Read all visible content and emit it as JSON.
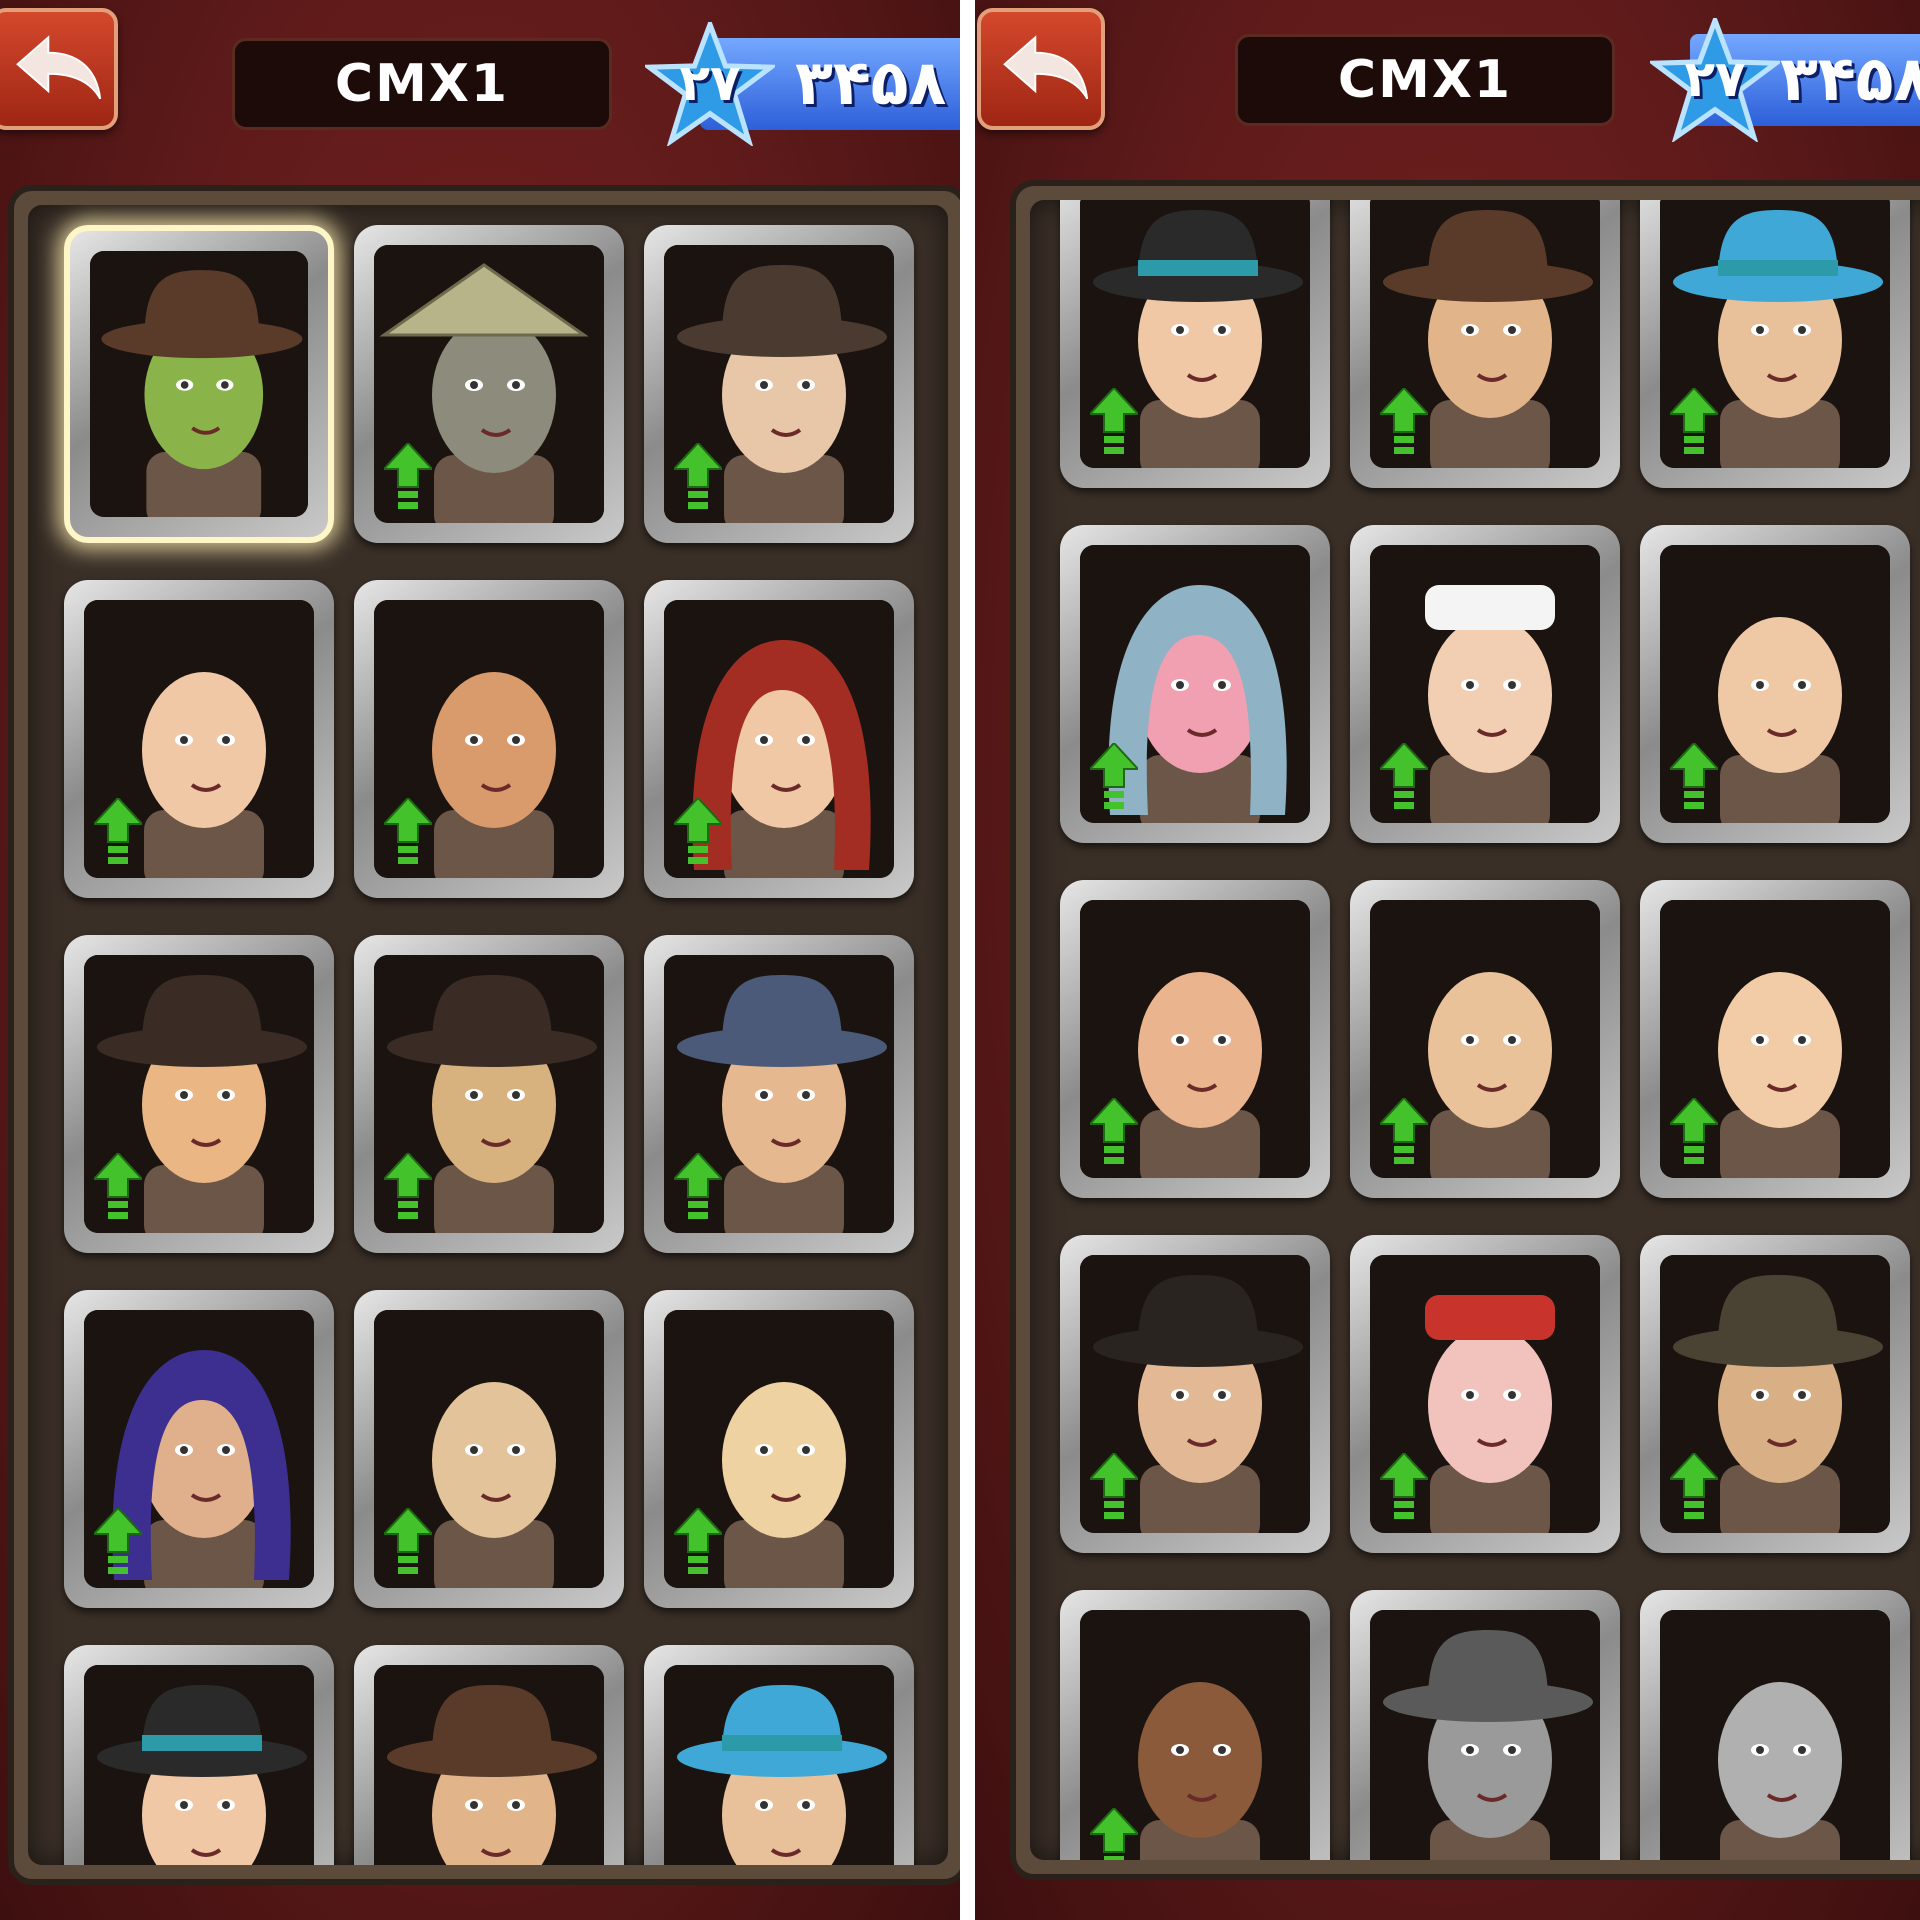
{
  "header": {
    "player_name": "CMX1",
    "level": "۲۷",
    "score": "۳۴۵۸"
  },
  "colors": {
    "background": "#5e1a1a",
    "back_button": "#c23a20",
    "star": "#2f9be6",
    "score_bar": "#3b6fe0",
    "upgrade_arrow": "#44c22c",
    "panel": "#3a2f27"
  },
  "left_screen": {
    "selected_card": 0,
    "cards": [
      {
        "character": "zombie-fedora",
        "skin": "#8ab34a",
        "hat": "fedora-brown",
        "upgrade": false
      },
      {
        "character": "conical-hat-masked-woman",
        "skin": "#8c8b7c",
        "hat": "conical",
        "upgrade": true
      },
      {
        "character": "goggles-pilot-woman",
        "skin": "#e8c6a8",
        "hat": "goggles",
        "upgrade": true
      },
      {
        "character": "curly-hair-woman",
        "skin": "#f0c8a6",
        "hat": "none",
        "upgrade": true
      },
      {
        "character": "bald-thug",
        "skin": "#d99a6c",
        "hat": "none",
        "upgrade": true
      },
      {
        "character": "red-hood-woman",
        "skin": "#f0c8a6",
        "hat": "red-hood",
        "upgrade": true
      },
      {
        "character": "fat-fedora-gangster",
        "skin": "#e9b684",
        "hat": "fedora-dark",
        "upgrade": true
      },
      {
        "character": "glasses-fedora-man",
        "skin": "#d7b27f",
        "hat": "fedora-dark",
        "upgrade": true
      },
      {
        "character": "helmet-masked-rider",
        "skin": "#e6b88f",
        "hat": "helmet-blue",
        "upgrade": true
      },
      {
        "character": "purple-veil-woman",
        "skin": "#e0b08c",
        "hat": "purple-veil",
        "upgrade": true
      },
      {
        "character": "sunglasses-fur-lady",
        "skin": "#e3c39a",
        "hat": "none",
        "upgrade": true
      },
      {
        "character": "scarred-tattoo-man",
        "skin": "#efd2a2",
        "hat": "none",
        "upgrade": true
      },
      {
        "character": "teal-band-hat-woman",
        "skin": "#f0c8a6",
        "hat": "cloche-teal",
        "upgrade": false
      },
      {
        "character": "brown-fedora-man",
        "skin": "#e2b489",
        "hat": "fedora-brown",
        "upgrade": false
      },
      {
        "character": "blue-helmet-policeman",
        "skin": "#e8c09a",
        "hat": "bobby-blue",
        "upgrade": false
      }
    ]
  },
  "right_screen": {
    "cards": [
      {
        "character": "teal-band-hat-woman",
        "skin": "#f0c8a6",
        "hat": "cloche-teal",
        "upgrade": true
      },
      {
        "character": "brown-fedora-man",
        "skin": "#e2b489",
        "hat": "fedora-brown",
        "upgrade": true
      },
      {
        "character": "blue-helmet-policeman",
        "skin": "#e8c09a",
        "hat": "bobby-blue",
        "upgrade": true
      },
      {
        "character": "headscarf-old-pig-lady",
        "skin": "#f0a0b0",
        "hat": "headscarf",
        "upgrade": true
      },
      {
        "character": "nurse-red-hair",
        "skin": "#f2cfb2",
        "hat": "nurse-cap",
        "upgrade": true
      },
      {
        "character": "curly-ginger-man",
        "skin": "#efc9a6",
        "hat": "none",
        "upgrade": true
      },
      {
        "character": "mustache-strongman",
        "skin": "#eab48e",
        "hat": "none",
        "upgrade": true
      },
      {
        "character": "pompadour-man",
        "skin": "#eac29a",
        "hat": "none",
        "upgrade": true
      },
      {
        "character": "mad-scientist",
        "skin": "#f1cca6",
        "hat": "none",
        "upgrade": true
      },
      {
        "character": "fat-bowler-man",
        "skin": "#e3b995",
        "hat": "bowler",
        "upgrade": true
      },
      {
        "character": "bandana-fat-man",
        "skin": "#f2c3bd",
        "hat": "bandana",
        "upgrade": true
      },
      {
        "character": "cap-sunglasses-man",
        "skin": "#d9b085",
        "hat": "flat-cap",
        "upgrade": true
      },
      {
        "character": "afro-sunglasses-woman",
        "skin": "#8a5a3a",
        "hat": "none",
        "upgrade": true
      },
      {
        "character": "cap-bearded-man-locked",
        "skin": "#9a9a9a",
        "hat": "flat-cap-gray",
        "upgrade": false
      },
      {
        "character": "bald-glasses-man-locked",
        "skin": "#b0b0b0",
        "hat": "none",
        "upgrade": false
      }
    ]
  }
}
